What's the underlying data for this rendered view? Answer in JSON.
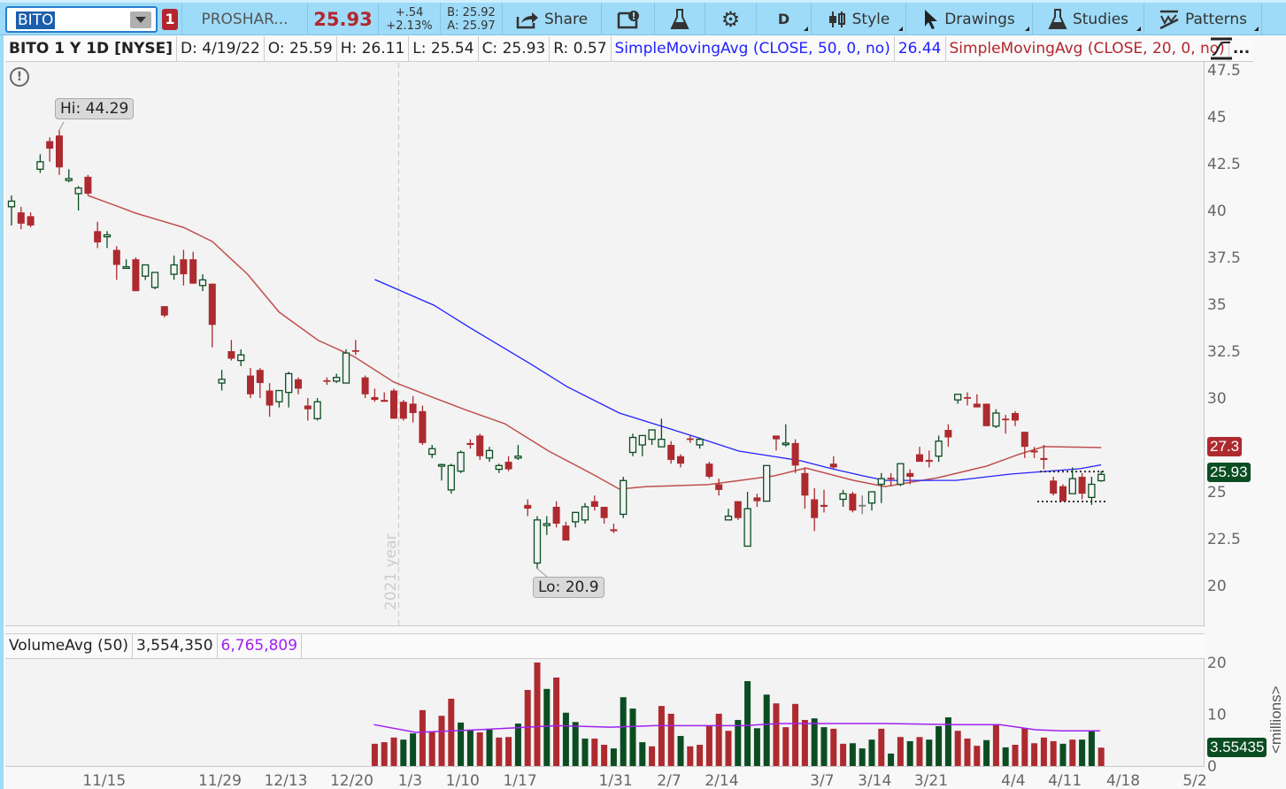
{
  "toolbar": {
    "symbol": "BITO",
    "alert_count": "1",
    "description": "PROSHAR...",
    "last_price": "25.93",
    "change": "+.54",
    "change_pct": "+2.13%",
    "bid": "B: 25.92",
    "ask": "A: 25.97",
    "share_label": "Share",
    "aggregation": "D",
    "style_label": "Style",
    "drawings_label": "Drawings",
    "studies_label": "Studies",
    "patterns_label": "Patterns"
  },
  "info": {
    "title": "BITO 1 Y 1D [NYSE]",
    "date": "D: 4/19/22",
    "open": "O: 25.59",
    "high": "H: 26.11",
    "low": "L: 25.54",
    "close": "C: 25.93",
    "range": "R: 0.57",
    "sma50_label": "SimpleMovingAvg (CLOSE, 50, 0, no)",
    "sma50_value": "26.44",
    "sma20_label": "SimpleMovingAvg (CLOSE, 20, 0, no)",
    "more": "..."
  },
  "colors": {
    "up": "#0b4d22",
    "down": "#ad2a2f",
    "sma50": "#2222ff",
    "sma20": "#c0504d",
    "volavg": "#a020f0",
    "toolbar": "#9edbf8"
  },
  "chart_data": {
    "type": "candlestick",
    "ylim": [
      18.9,
      48.0
    ],
    "y_ticks": [
      "47.5",
      "45",
      "42.5",
      "40",
      "37.5",
      "35",
      "32.5",
      "30",
      "27.5",
      "25",
      "22.5",
      "20"
    ],
    "x_ticks": [
      {
        "label": "11/15",
        "bar": 9.7
      },
      {
        "label": "11/29",
        "bar": 21.8
      },
      {
        "label": "12/13",
        "bar": 28.7
      },
      {
        "label": "12/20",
        "bar": 35.6
      },
      {
        "label": "1/3",
        "bar": 41.7
      },
      {
        "label": "1/10",
        "bar": 47.2
      },
      {
        "label": "1/17",
        "bar": 53.2
      },
      {
        "label": "1/31",
        "bar": 63.2
      },
      {
        "label": "2/7",
        "bar": 68.8
      },
      {
        "label": "2/14",
        "bar": 74.3
      },
      {
        "label": "3/7",
        "bar": 84.8
      },
      {
        "label": "3/14",
        "bar": 90.3
      },
      {
        "label": "3/21",
        "bar": 96.2
      },
      {
        "label": "4/4",
        "bar": 104.8
      },
      {
        "label": "4/11",
        "bar": 110.2
      },
      {
        "label": "4/18",
        "bar": 116.3
      },
      {
        "label": "5/2",
        "bar": 123.8
      }
    ],
    "ohlc": [
      [
        40.2,
        40.8,
        39.2,
        40.5
      ],
      [
        39.9,
        40.2,
        39.0,
        39.3
      ],
      [
        39.7,
        39.9,
        39.1,
        39.2
      ],
      [
        42.2,
        43.0,
        42.0,
        42.6
      ],
      [
        43.7,
        43.9,
        42.6,
        43.3
      ],
      [
        44.0,
        44.29,
        41.9,
        42.3
      ],
      [
        41.6,
        42.2,
        41.5,
        41.7
      ],
      [
        40.9,
        41.3,
        40.0,
        41.2
      ],
      [
        41.8,
        41.9,
        40.8,
        40.9
      ],
      [
        38.9,
        39.4,
        38.0,
        38.3
      ],
      [
        38.6,
        38.9,
        38.0,
        38.7
      ],
      [
        37.9,
        38.1,
        36.3,
        37.1
      ],
      [
        36.95,
        37.4,
        36.9,
        37.0
      ],
      [
        37.4,
        37.5,
        35.7,
        35.7
      ],
      [
        36.5,
        37.1,
        36.3,
        37.1
      ],
      [
        35.9,
        36.7,
        35.8,
        36.7
      ],
      [
        34.9,
        34.9,
        34.3,
        34.4
      ],
      [
        36.6,
        37.6,
        36.3,
        37.1
      ],
      [
        37.4,
        37.9,
        36.0,
        36.6
      ],
      [
        37.4,
        37.8,
        36.1,
        36.1
      ],
      [
        36.0,
        36.6,
        35.7,
        36.3
      ],
      [
        36.1,
        36.1,
        32.7,
        33.9
      ],
      [
        30.8,
        31.5,
        30.4,
        31.0
      ],
      [
        32.5,
        33.1,
        32.0,
        32.1
      ],
      [
        32.0,
        32.6,
        31.7,
        32.3
      ],
      [
        31.2,
        31.6,
        30.0,
        30.2
      ],
      [
        31.5,
        31.6,
        30.0,
        30.8
      ],
      [
        30.4,
        30.8,
        29.0,
        29.6
      ],
      [
        29.8,
        30.4,
        29.5,
        30.4
      ],
      [
        30.3,
        31.4,
        29.5,
        31.3
      ],
      [
        31.0,
        31.1,
        30.2,
        30.5
      ],
      [
        29.6,
        30.0,
        28.8,
        29.4
      ],
      [
        28.9,
        30.0,
        28.8,
        29.8
      ],
      [
        30.95,
        31.1,
        30.7,
        30.9
      ],
      [
        30.9,
        31.3,
        30.8,
        31.1
      ],
      [
        30.8,
        32.6,
        30.8,
        32.4
      ],
      [
        32.55,
        33.1,
        32.3,
        32.5
      ],
      [
        31.1,
        31.2,
        30.0,
        30.2
      ],
      [
        30.05,
        30.5,
        29.8,
        29.9
      ],
      [
        29.9,
        30.3,
        29.8,
        29.8
      ],
      [
        30.4,
        30.5,
        28.9,
        28.9
      ],
      [
        29.8,
        29.9,
        28.8,
        28.9
      ],
      [
        29.7,
        30.1,
        28.7,
        29.2
      ],
      [
        29.3,
        29.6,
        27.5,
        27.6
      ],
      [
        27.0,
        27.5,
        26.8,
        27.3
      ],
      [
        26.4,
        26.5,
        25.6,
        26.45
      ],
      [
        25.1,
        26.5,
        24.9,
        26.4
      ],
      [
        26.1,
        27.2,
        26.0,
        27.1
      ],
      [
        27.6,
        27.8,
        27.3,
        27.5
      ],
      [
        28.0,
        28.1,
        26.7,
        26.9
      ],
      [
        26.8,
        27.4,
        26.6,
        27.2
      ],
      [
        26.2,
        26.5,
        26.0,
        26.4
      ],
      [
        26.6,
        26.9,
        26.1,
        26.2
      ],
      [
        26.8,
        27.5,
        26.7,
        26.9
      ],
      [
        24.3,
        24.6,
        23.7,
        24.1
      ],
      [
        21.2,
        23.7,
        20.9,
        23.5
      ],
      [
        23.2,
        23.7,
        22.7,
        23.3
      ],
      [
        24.2,
        24.5,
        23.1,
        23.3
      ],
      [
        23.2,
        23.4,
        22.4,
        22.4
      ],
      [
        23.4,
        23.9,
        23.1,
        23.9
      ],
      [
        23.5,
        24.4,
        23.3,
        24.2
      ],
      [
        24.5,
        24.8,
        24.0,
        24.2
      ],
      [
        24.2,
        24.2,
        23.3,
        23.6
      ],
      [
        23.0,
        23.3,
        22.8,
        22.9
      ],
      [
        23.8,
        25.8,
        23.6,
        25.6
      ],
      [
        27.1,
        28.1,
        26.9,
        27.9
      ],
      [
        27.5,
        28.0,
        26.9,
        28.0
      ],
      [
        27.8,
        28.3,
        27.5,
        28.3
      ],
      [
        27.4,
        28.9,
        27.4,
        27.8
      ],
      [
        27.5,
        27.7,
        26.5,
        26.7
      ],
      [
        26.9,
        27.0,
        26.3,
        26.5
      ],
      [
        27.85,
        28.0,
        27.6,
        27.8
      ],
      [
        27.5,
        27.9,
        27.3,
        27.8
      ],
      [
        26.5,
        26.6,
        25.7,
        25.8
      ],
      [
        25.4,
        25.7,
        24.8,
        25.1
      ],
      [
        23.5,
        24.1,
        23.5,
        23.7
      ],
      [
        24.5,
        24.5,
        23.5,
        23.6
      ],
      [
        22.1,
        25.0,
        22.1,
        24.1
      ],
      [
        24.7,
        24.9,
        24.2,
        24.5
      ],
      [
        24.5,
        26.4,
        24.5,
        26.4
      ],
      [
        28.0,
        28.0,
        27.2,
        27.8
      ],
      [
        27.55,
        28.6,
        27.4,
        27.6
      ],
      [
        27.6,
        27.8,
        26.0,
        26.4
      ],
      [
        26.0,
        26.3,
        24.1,
        24.8
      ],
      [
        24.6,
        25.2,
        22.9,
        23.6
      ],
      [
        24.3,
        25.1,
        23.9,
        24.2
      ],
      [
        26.5,
        26.9,
        26.2,
        26.3
      ],
      [
        24.6,
        25.1,
        24.2,
        24.9
      ],
      [
        24.9,
        25.0,
        23.9,
        24.0
      ],
      [
        24.3,
        24.8,
        23.8,
        24.3
      ],
      [
        24.4,
        25.0,
        24.0,
        25.0
      ],
      [
        25.4,
        26.0,
        24.4,
        25.7
      ],
      [
        25.75,
        26.0,
        25.3,
        25.7
      ],
      [
        25.4,
        26.5,
        25.3,
        26.5
      ],
      [
        26.0,
        26.2,
        25.4,
        25.8
      ],
      [
        27.0,
        27.4,
        26.6,
        26.6
      ],
      [
        26.7,
        27.2,
        26.3,
        26.6
      ],
      [
        26.9,
        28.0,
        26.6,
        27.7
      ],
      [
        28.3,
        28.6,
        27.4,
        27.9
      ],
      [
        29.9,
        30.2,
        29.7,
        30.2
      ],
      [
        30.05,
        30.3,
        29.6,
        30.0
      ],
      [
        29.7,
        30.2,
        29.5,
        29.5
      ],
      [
        29.7,
        29.7,
        28.5,
        28.5
      ],
      [
        28.5,
        29.4,
        28.4,
        29.2
      ],
      [
        28.9,
        29.1,
        28.1,
        28.85
      ],
      [
        29.2,
        29.3,
        28.5,
        28.8
      ],
      [
        28.2,
        28.2,
        26.8,
        27.4
      ],
      [
        27.2,
        27.4,
        26.8,
        27.1
      ],
      [
        26.8,
        27.5,
        26.2,
        26.7
      ],
      [
        25.6,
        25.8,
        24.8,
        24.9
      ],
      [
        25.3,
        25.4,
        24.5,
        24.5
      ],
      [
        24.9,
        26.3,
        24.9,
        25.7
      ],
      [
        25.8,
        26.0,
        24.6,
        24.9
      ],
      [
        24.7,
        25.8,
        24.3,
        25.4
      ],
      [
        25.59,
        26.11,
        25.54,
        25.93
      ]
    ],
    "sma20": [
      [
        8,
        40.8
      ],
      [
        10.8,
        40.28
      ],
      [
        13,
        39.86
      ],
      [
        18,
        39.1
      ],
      [
        21,
        38.35
      ],
      [
        24.7,
        36.6
      ],
      [
        28,
        34.58
      ],
      [
        32.1,
        33.07
      ],
      [
        35.8,
        32.22
      ],
      [
        40,
        30.85
      ],
      [
        44,
        30.05
      ],
      [
        47.4,
        29.39
      ],
      [
        51.6,
        28.63
      ],
      [
        56.2,
        27.17
      ],
      [
        60.8,
        25.94
      ],
      [
        63.6,
        25.14
      ],
      [
        66.4,
        25.28
      ],
      [
        72.9,
        25.38
      ],
      [
        79.8,
        25.85
      ],
      [
        83.1,
        26.27
      ],
      [
        88.1,
        25.61
      ],
      [
        91.4,
        25.28
      ],
      [
        96.9,
        25.75
      ],
      [
        102,
        26.37
      ],
      [
        105.3,
        26.98
      ],
      [
        108,
        27.41
      ],
      [
        114,
        27.36
      ]
    ],
    "sma50": [
      [
        38,
        36.32
      ],
      [
        44.2,
        34.95
      ],
      [
        47.9,
        33.77
      ],
      [
        54.4,
        31.79
      ],
      [
        58.1,
        30.61
      ],
      [
        63.6,
        29.2
      ],
      [
        71,
        28.02
      ],
      [
        76.1,
        27.17
      ],
      [
        80.3,
        26.84
      ],
      [
        82.6,
        26.65
      ],
      [
        85.8,
        26.23
      ],
      [
        89.1,
        25.85
      ],
      [
        91.4,
        25.61
      ],
      [
        98.8,
        25.61
      ],
      [
        104.4,
        25.94
      ],
      [
        111.8,
        26.23
      ],
      [
        114,
        26.44
      ]
    ],
    "range_lines": [
      26.08,
      24.48
    ],
    "hi_label": "Hi: 44.29",
    "lo_label": "Lo: 20.9",
    "year_marker": "2021 year",
    "sma20_price_label": "27.3",
    "last_price_label": "25.93",
    "volume": {
      "title": "VolumeAvg (50)",
      "current": "3,554,350",
      "average": "6,765,809",
      "units": "<millions>",
      "last_label": "3.55435",
      "y_ticks": [
        "20",
        "10",
        "0"
      ],
      "start_bar": 38,
      "values": [
        4.3,
        4.6,
        5.5,
        5.1,
        6.3,
        10.8,
        6.6,
        9.7,
        13.0,
        8.4,
        7.0,
        6.5,
        7.2,
        5.5,
        5.6,
        8.2,
        14.7,
        20.0,
        14.9,
        17.1,
        10.3,
        8.5,
        5.3,
        5.3,
        4.1,
        3.4,
        13.3,
        11.1,
        4.6,
        3.8,
        11.6,
        10.1,
        5.8,
        3.8,
        4.1,
        7.7,
        10.1,
        6.8,
        8.9,
        16.4,
        7.3,
        13.8,
        12.1,
        7.5,
        12.0,
        8.9,
        9.2,
        7.5,
        7.2,
        4.3,
        4.4,
        3.4,
        5.1,
        7.2,
        2.4,
        5.6,
        4.8,
        5.6,
        5.1,
        7.7,
        9.4,
        6.8,
        5.3,
        3.9,
        5.0,
        8.0,
        3.6,
        4.1,
        7.3,
        4.4,
        5.5,
        4.8,
        4.3,
        5.1,
        5.1,
        6.8,
        3.55
      ],
      "directions": "dddUUddddUUdUddUddUdUUUddUUUUdddUdddddUUUUddddUUddUUUdUdUdUUUdddUdUdddddUdUU",
      "avg_line": [
        [
          37.9,
          8.0
        ],
        [
          42.3,
          6.5
        ],
        [
          48.8,
          7.0
        ],
        [
          57.1,
          7.8
        ],
        [
          62.7,
          7.5
        ],
        [
          67.3,
          7.8
        ],
        [
          76.6,
          7.8
        ],
        [
          80.3,
          8.2
        ],
        [
          91.4,
          8.2
        ],
        [
          98.8,
          8.0
        ],
        [
          103.4,
          8.0
        ],
        [
          107.1,
          7.0
        ],
        [
          109.9,
          6.8
        ],
        [
          113.9,
          6.8
        ]
      ]
    }
  }
}
